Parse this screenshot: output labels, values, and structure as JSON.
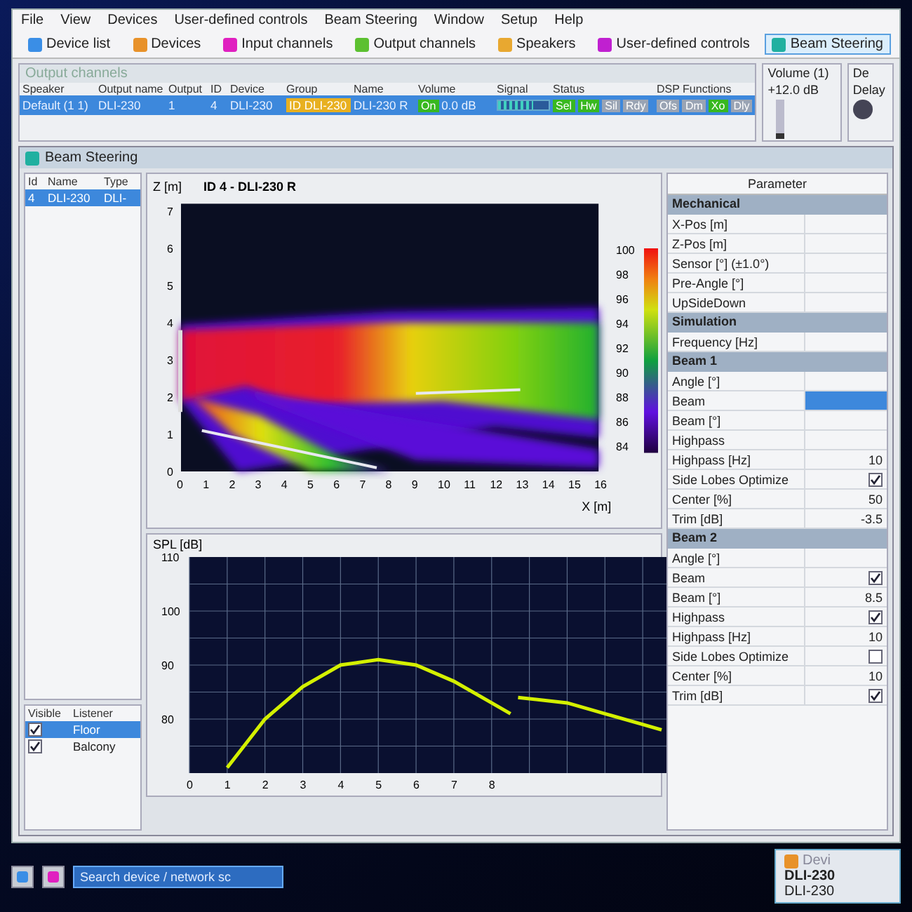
{
  "menu": [
    "File",
    "View",
    "Devices",
    "User-defined controls",
    "Beam Steering",
    "Window",
    "Setup",
    "Help"
  ],
  "toolbar": [
    {
      "label": "Device list",
      "color": "#3a8ee6",
      "selected": false
    },
    {
      "label": "Devices",
      "color": "#e8922a",
      "selected": false
    },
    {
      "label": "Input channels",
      "color": "#e020c0",
      "selected": false
    },
    {
      "label": "Output channels",
      "color": "#5cc030",
      "selected": false
    },
    {
      "label": "Speakers",
      "color": "#e8a830",
      "selected": false
    },
    {
      "label": "User-defined controls",
      "color": "#c020d0",
      "selected": false
    },
    {
      "label": "Beam Steering",
      "color": "#20b0a0",
      "selected": true
    }
  ],
  "output_panel": {
    "title": "Output channels",
    "columns": [
      "Speaker",
      "Output name",
      "Output",
      "ID",
      "Device",
      "Group",
      "Name",
      "Volume",
      "Signal",
      "Status",
      "DSP Functions"
    ],
    "row": {
      "selected": true,
      "speaker": "Default (1 1)",
      "output_name": "DLI-230",
      "output": "1",
      "id": "4",
      "device": "DLI-230",
      "group": "ID DLI-230",
      "name": "DLI-230 R",
      "mute": {
        "label": "On",
        "on": true
      },
      "volume": "0.0 dB",
      "signal": {
        "level": 0.7
      },
      "status": [
        {
          "label": "Sel",
          "on": true
        },
        {
          "label": "Hw",
          "on": true
        },
        {
          "label": "Sil",
          "on": false
        },
        {
          "label": "Rdy",
          "on": false
        }
      ],
      "dsp": [
        {
          "label": "Ofs",
          "on": false
        },
        {
          "label": "Dm",
          "on": false
        },
        {
          "label": "Xo",
          "on": true
        },
        {
          "label": "Dly",
          "on": false
        }
      ]
    }
  },
  "volume_panel": {
    "title": "Volume (1)",
    "reading": "+12.0 dB",
    "level": 0.15
  },
  "delay_panel": {
    "title": "De",
    "label": "Delay"
  },
  "beam_window": {
    "title": "Beam Steering",
    "device_list": {
      "columns": [
        "Id",
        "Name",
        "Type"
      ],
      "rows": [
        {
          "id": "4",
          "name": "DLI-230",
          "type": "DLI-",
          "selected": true
        }
      ]
    },
    "listeners": {
      "columns": [
        "Visible",
        "Listener"
      ],
      "rows": [
        {
          "visible": true,
          "name": "Floor",
          "selected": true
        },
        {
          "visible": true,
          "name": "Balcony",
          "selected": false
        }
      ]
    },
    "heatmap": {
      "y_label": "Z [m]",
      "title": "ID 4 - DLI-230 R",
      "x_label": "X [m]",
      "y_ticks": [
        "7",
        "6",
        "5",
        "4",
        "3",
        "2",
        "1",
        "0"
      ],
      "x_ticks": [
        "0",
        "1",
        "2",
        "3",
        "4",
        "5",
        "6",
        "7",
        "8",
        "9",
        "10",
        "11",
        "12",
        "13",
        "14",
        "15",
        "16"
      ],
      "scale": [
        "100",
        "98",
        "96",
        "94",
        "92",
        "90",
        "88",
        "86",
        "84"
      ]
    },
    "spl_chart": {
      "chart_data": {
        "type": "line",
        "grid": true,
        "ylabel": "SPL [dB]",
        "xlim": [
          0,
          13
        ],
        "ylim": [
          70,
          110
        ],
        "xticks": [
          0,
          1,
          2,
          3,
          4,
          5,
          6,
          7,
          8
        ],
        "yticks": [
          80,
          90,
          100,
          110
        ],
        "x": [
          1,
          2,
          3,
          4,
          5,
          6,
          7,
          8,
          8.5,
          8.6,
          8.7,
          10,
          11,
          12,
          12.5
        ],
        "series": [
          {
            "color": "#d4f000",
            "values": [
              71,
              80,
              86,
              90,
              91,
              90,
              87,
              83,
              81,
              null,
              84,
              83,
              81,
              79,
              78
            ]
          }
        ]
      }
    },
    "parameters": {
      "title": "Parameter",
      "sections": [
        {
          "title": "Mechanical",
          "rows": [
            {
              "label": "X-Pos [m]",
              "kind": "none",
              "selected": false
            },
            {
              "label": "Z-Pos [m]",
              "kind": "none",
              "selected": false
            },
            {
              "label": "Sensor [°] (±1.0°)",
              "kind": "none",
              "selected": false
            },
            {
              "label": "Pre-Angle [°]",
              "kind": "none",
              "selected": false
            },
            {
              "label": "UpSideDown",
              "kind": "none",
              "selected": false
            }
          ]
        },
        {
          "title": "Simulation",
          "rows": [
            {
              "label": "Frequency [Hz]",
              "kind": "none",
              "selected": false
            }
          ]
        },
        {
          "title": "Beam 1",
          "rows": [
            {
              "label": "Angle [°]",
              "kind": "none",
              "selected": false
            },
            {
              "label": "Beam",
              "kind": "none",
              "selected": true
            },
            {
              "label": "Beam [°]",
              "kind": "none",
              "selected": false
            },
            {
              "label": "Highpass",
              "kind": "none",
              "selected": false
            },
            {
              "label": "Highpass [Hz]",
              "kind": "text",
              "value": "10",
              "selected": false
            },
            {
              "label": "Side Lobes Optimize",
              "kind": "check",
              "checked": true,
              "selected": false
            },
            {
              "label": "Center [%]",
              "kind": "text",
              "value": "50",
              "selected": false
            },
            {
              "label": "Trim [dB]",
              "kind": "text",
              "value": "-3.5",
              "selected": false
            }
          ]
        },
        {
          "title": "Beam 2",
          "rows": [
            {
              "label": "Angle [°]",
              "kind": "none",
              "selected": false
            },
            {
              "label": "Beam",
              "kind": "check",
              "checked": true,
              "selected": false
            },
            {
              "label": "Beam [°]",
              "kind": "text",
              "value": "8.5",
              "selected": false
            },
            {
              "label": "Highpass",
              "kind": "check",
              "checked": true,
              "selected": false
            },
            {
              "label": "Highpass [Hz]",
              "kind": "text",
              "value": "10",
              "selected": false
            },
            {
              "label": "Side Lobes Optimize",
              "kind": "check",
              "checked": false,
              "selected": false
            },
            {
              "label": "Center [%]",
              "kind": "text",
              "value": "10",
              "selected": false
            },
            {
              "label": "Trim [dB]",
              "kind": "check",
              "checked": true,
              "selected": false
            }
          ]
        }
      ]
    }
  },
  "bottom_bar": {
    "search": {
      "placeholder": "Search device / network sc"
    },
    "device_card": {
      "title": "Devi",
      "name": "DLI-230",
      "model": "DLI-230"
    }
  }
}
